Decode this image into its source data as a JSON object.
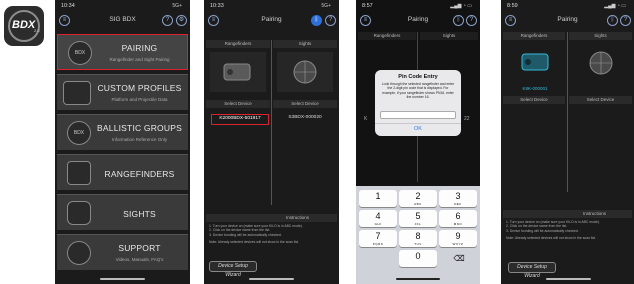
{
  "app_icon": {
    "text": "BDX",
    "sup": "2.0"
  },
  "screen1": {
    "time": "10:34",
    "signal": "5G+",
    "title": "SIG BDX",
    "left_icon": "menu-icon",
    "help": "?",
    "settings": "gear-icon",
    "items": [
      {
        "label": "PAIRING",
        "sub": "Rangefinder and Sight Pairing",
        "icon": "BDX"
      },
      {
        "label": "CUSTOM PROFILES",
        "sub": "Platform and Projectile Data",
        "icon": ""
      },
      {
        "label": "BALLISTIC GROUPS",
        "sub": "Information Reference Only",
        "icon": "BDX"
      },
      {
        "label": "RANGEFINDERS",
        "sub": "",
        "icon": ""
      },
      {
        "label": "SIGHTS",
        "sub": "",
        "icon": ""
      },
      {
        "label": "SUPPORT",
        "sub": "Videos, Manuals, FAQ's",
        "icon": ""
      }
    ]
  },
  "screen2": {
    "time": "10:33",
    "signal": "5G+",
    "title": "Pairing",
    "col_left": "Rangefinders",
    "col_right": "Sights",
    "select_left": "Select Device",
    "select_right": "Select Device",
    "device_left": "K2000BDX-501917",
    "device_right": "S3BDX-000020",
    "instructions_title": "Instructions",
    "instructions": [
      "1. Turn your device on (make sure your KILO is in ABC mode).",
      "2. Click on the device name from the list.",
      "3. Device bonding will be automatically checked.",
      "Note: Already selected devices will not show in the scan list."
    ],
    "wizard": "Device Setup Wizard"
  },
  "screen3": {
    "time": "8:57",
    "title": "Pairing",
    "col_left": "Rangefinders",
    "col_right": "Sights",
    "dialog_title": "Pin Code Entry",
    "dialog_body": "Look through the selected rangefinder and enter the 2-digit pin code that is displayed. For example, if your rangefinder shows PN16, enter the number 16.",
    "input_value": "",
    "ok": "OK",
    "partial_left": "K",
    "partial_right": "22",
    "keys": [
      {
        "n": "1",
        "l": ""
      },
      {
        "n": "2",
        "l": "ABC"
      },
      {
        "n": "3",
        "l": "DEF"
      },
      {
        "n": "4",
        "l": "GHI"
      },
      {
        "n": "5",
        "l": "JKL"
      },
      {
        "n": "6",
        "l": "MNO"
      },
      {
        "n": "7",
        "l": "PQRS"
      },
      {
        "n": "8",
        "l": "TUV"
      },
      {
        "n": "9",
        "l": "WXYZ"
      },
      {
        "n": "0",
        "l": ""
      }
    ]
  },
  "screen4": {
    "time": "8:59",
    "title": "Pairing",
    "col_left": "Rangefinders",
    "col_right": "Sights",
    "device_left": "K8K-000001",
    "select_left": "Select Device",
    "select_right": "Select Device",
    "instructions_title": "Instructions",
    "instructions": [
      "1. Turn your device on (make sure your KILO is in ABC mode).",
      "2. Click on the device name from the list.",
      "3. Device bonding will be automatically checked.",
      "Note: Already selected devices will not show in the scan list."
    ],
    "wizard": "Device Setup Wizard"
  }
}
